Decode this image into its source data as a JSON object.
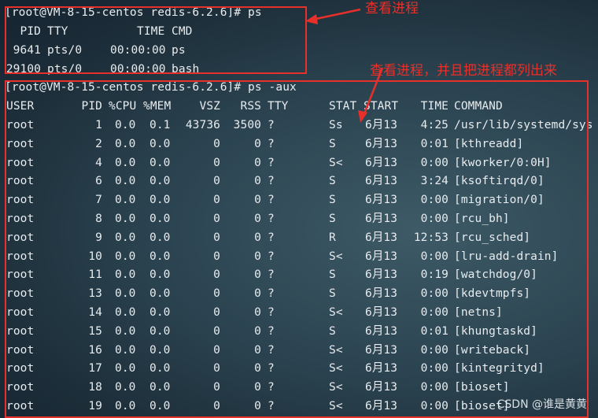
{
  "prompts": {
    "ps": "[root@VM-8-15-centos redis-6.2.6]# ps",
    "ps_aux": "[root@VM-8-15-centos redis-6.2.6]# ps -aux"
  },
  "ps_table": {
    "headers": [
      "PID",
      "TTY",
      "TIME",
      "CMD"
    ],
    "rows": [
      [
        "9641",
        "pts/0",
        "00:00:00",
        "ps"
      ],
      [
        "29100",
        "pts/0",
        "00:00:00",
        "bash"
      ]
    ]
  },
  "aux_table": {
    "headers": [
      "USER",
      "PID",
      "%CPU",
      "%MEM",
      "VSZ",
      "RSS",
      "TTY",
      "STAT",
      "START",
      "TIME",
      "COMMAND"
    ],
    "rows": [
      [
        "root",
        "1",
        "0.0",
        "0.1",
        "43736",
        "3500",
        "?",
        "Ss",
        "6月13",
        "4:25",
        "/usr/lib/systemd/sys"
      ],
      [
        "root",
        "2",
        "0.0",
        "0.0",
        "0",
        "0",
        "?",
        "S",
        "6月13",
        "0:01",
        "[kthreadd]"
      ],
      [
        "root",
        "4",
        "0.0",
        "0.0",
        "0",
        "0",
        "?",
        "S<",
        "6月13",
        "0:00",
        "[kworker/0:0H]"
      ],
      [
        "root",
        "6",
        "0.0",
        "0.0",
        "0",
        "0",
        "?",
        "S",
        "6月13",
        "3:24",
        "[ksoftirqd/0]"
      ],
      [
        "root",
        "7",
        "0.0",
        "0.0",
        "0",
        "0",
        "?",
        "S",
        "6月13",
        "0:00",
        "[migration/0]"
      ],
      [
        "root",
        "8",
        "0.0",
        "0.0",
        "0",
        "0",
        "?",
        "S",
        "6月13",
        "0:00",
        "[rcu_bh]"
      ],
      [
        "root",
        "9",
        "0.0",
        "0.0",
        "0",
        "0",
        "?",
        "R",
        "6月13",
        "12:53",
        "[rcu_sched]"
      ],
      [
        "root",
        "10",
        "0.0",
        "0.0",
        "0",
        "0",
        "?",
        "S<",
        "6月13",
        "0:00",
        "[lru-add-drain]"
      ],
      [
        "root",
        "11",
        "0.0",
        "0.0",
        "0",
        "0",
        "?",
        "S",
        "6月13",
        "0:19",
        "[watchdog/0]"
      ],
      [
        "root",
        "13",
        "0.0",
        "0.0",
        "0",
        "0",
        "?",
        "S",
        "6月13",
        "0:00",
        "[kdevtmpfs]"
      ],
      [
        "root",
        "14",
        "0.0",
        "0.0",
        "0",
        "0",
        "?",
        "S<",
        "6月13",
        "0:00",
        "[netns]"
      ],
      [
        "root",
        "15",
        "0.0",
        "0.0",
        "0",
        "0",
        "?",
        "S",
        "6月13",
        "0:01",
        "[khungtaskd]"
      ],
      [
        "root",
        "16",
        "0.0",
        "0.0",
        "0",
        "0",
        "?",
        "S<",
        "6月13",
        "0:00",
        "[writeback]"
      ],
      [
        "root",
        "17",
        "0.0",
        "0.0",
        "0",
        "0",
        "?",
        "S<",
        "6月13",
        "0:00",
        "[kintegrityd]"
      ],
      [
        "root",
        "18",
        "0.0",
        "0.0",
        "0",
        "0",
        "?",
        "S<",
        "6月13",
        "0:00",
        "[bioset]"
      ],
      [
        "root",
        "19",
        "0.0",
        "0.0",
        "0",
        "0",
        "?",
        "S<",
        "6月13",
        "0:00",
        "[bioset]"
      ]
    ]
  },
  "annotations": {
    "view_process": "查看进程",
    "view_all_process": "查看进程，并且把进程都列出来"
  },
  "watermark": "CSDN @谁是黄黄",
  "colors": {
    "annotation": "#e8302a",
    "terminal_text": "#e8ecef"
  }
}
